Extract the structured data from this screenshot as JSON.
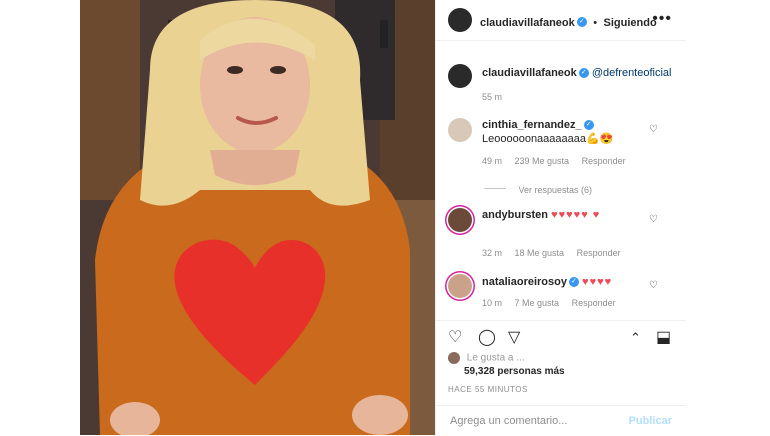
{
  "post": {
    "author": "claudiavillafaneok",
    "follow_label": "Siguiendo",
    "more_icon": "more-icon"
  },
  "caption": {
    "author": "claudiavillafaneok",
    "mention": "@defrenteoficial",
    "time": "55 m"
  },
  "comments": [
    {
      "user": "cinthia_fernandez_",
      "verified": true,
      "text": "Leoooooonaaaaaaaa💪😍",
      "time": "49 m",
      "likes": "239 Me gusta",
      "reply": "Responder"
    },
    {
      "user": "andybursten",
      "verified": false,
      "text": "♥♥♥♥♥ ♥",
      "time": "32 m",
      "likes": "18 Me gusta",
      "reply": "Responder"
    },
    {
      "user": "nataliaoreirosoy",
      "verified": true,
      "text": "♥♥♥♥",
      "time": "10 m",
      "likes": "7 Me gusta",
      "reply": "Responder"
    }
  ],
  "view_replies": "Ver respuestas (6)",
  "likes_summary": {
    "liked_by": "Le gusta a ...",
    "count": "59,328 personas más"
  },
  "timestamp": "HACE 55 MINUTOS",
  "add_comment": {
    "placeholder": "Agrega un comentario...",
    "publish": "Publicar"
  },
  "colors": {
    "sweater": "#c96a1c",
    "heart": "#e8302a",
    "verified": "#3897f0",
    "publish_disabled": "#b2dffc"
  }
}
